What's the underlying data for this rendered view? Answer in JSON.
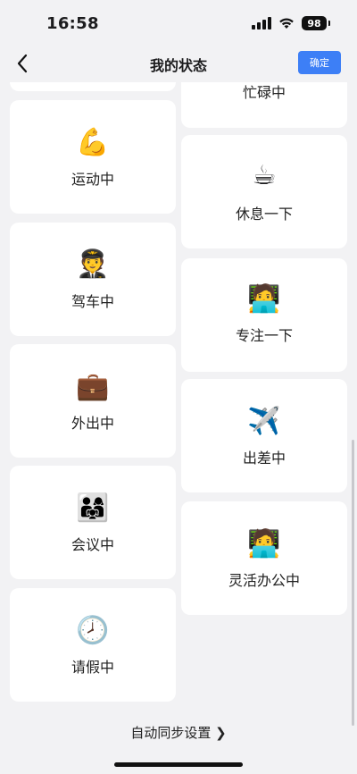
{
  "status_bar": {
    "time": "16:58",
    "battery": "98"
  },
  "nav": {
    "title": "我的状态",
    "confirm_label": "确定"
  },
  "left_cards": [
    {
      "label": "",
      "icon": ""
    },
    {
      "label": "运动中",
      "icon": "💪"
    },
    {
      "label": "驾车中",
      "icon": "🧑‍✈️"
    },
    {
      "label": "外出中",
      "icon": "💼"
    },
    {
      "label": "会议中",
      "icon": "👨‍👩‍👧"
    },
    {
      "label": "请假中",
      "icon": "🕗"
    }
  ],
  "right_cards": [
    {
      "label": "忙碌中",
      "icon": ""
    },
    {
      "label": "休息一下",
      "icon": "☕"
    },
    {
      "label": "专注一下",
      "icon": "🧑‍💻"
    },
    {
      "label": "出差中",
      "icon": "✈️"
    },
    {
      "label": "灵活办公中",
      "icon": "🧑‍💻"
    }
  ],
  "footer": {
    "sync_label": "自动同步设置 ❯"
  }
}
